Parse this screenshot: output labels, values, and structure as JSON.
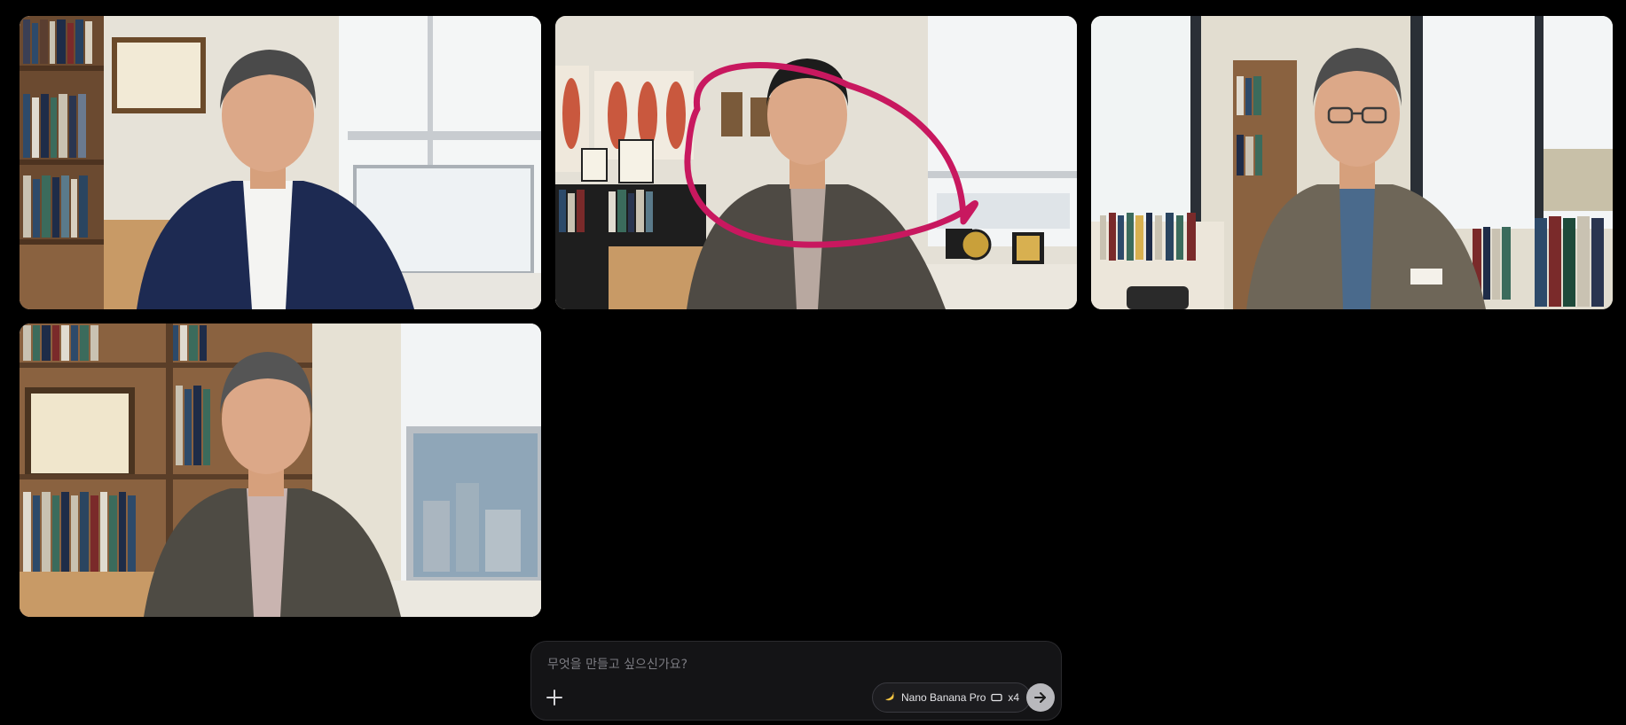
{
  "gallery": {
    "tiles": [
      {
        "alt": "Generated portrait 1"
      },
      {
        "alt": "Generated portrait 2"
      },
      {
        "alt": "Generated portrait 3"
      },
      {
        "alt": "Generated portrait 4"
      }
    ],
    "annotation_color": "#c8185f"
  },
  "composer": {
    "placeholder": "무엇을 만들고 싶으신가요?",
    "add_icon": "plus-icon",
    "model": {
      "icon": "banana-icon",
      "label": "Nano Banana Pro",
      "aspect_icon": "aspect-ratio-icon",
      "count": "x4"
    },
    "send_icon": "arrow-right-icon"
  },
  "colors": {
    "background": "#000000",
    "composer_bg": "#141416",
    "send_button": "#b8b8bc"
  }
}
